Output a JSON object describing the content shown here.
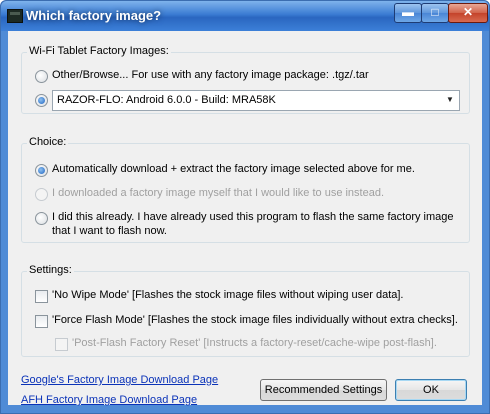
{
  "window": {
    "title": "Which factory image?",
    "minimize_glyph": "▬",
    "maximize_glyph": "□",
    "close_glyph": "✕"
  },
  "wifi_group": {
    "label": "Wi-Fi Tablet Factory Images:",
    "other_option": "Other/Browse...  For use with any factory image package: .tgz/.tar",
    "selected_image": "RAZOR-FLO: Android 6.0.0 - Build: MRA58K"
  },
  "choice_group": {
    "label": "Choice:",
    "auto_option": "Automatically download + extract the factory image selected above for me.",
    "manual_option": "I downloaded a factory image myself that I would like to use instead.",
    "already_option_line1": "I did this already. I have already used this program to flash the same factory image",
    "already_option_line2": "that I want to flash now."
  },
  "settings_group": {
    "label": "Settings:",
    "no_wipe": "'No Wipe Mode' [Flashes the stock image files without wiping user data].",
    "force_flash": "'Force Flash Mode' [Flashes the stock image files individually without extra checks].",
    "post_flash": "'Post-Flash Factory Reset' [Instructs a factory-reset/cache-wipe post-flash]."
  },
  "links": {
    "google": "Google's Factory Image Download Page",
    "afh": "AFH Factory Image Download Page"
  },
  "buttons": {
    "recommended": "Recommended Settings",
    "ok": "OK"
  }
}
